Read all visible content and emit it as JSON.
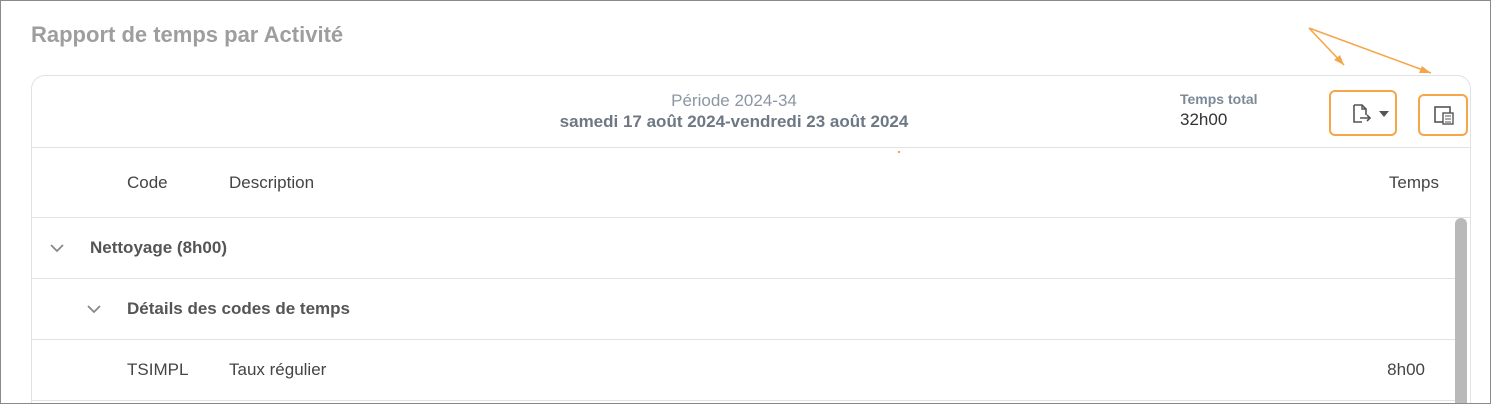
{
  "page": {
    "title": "Rapport de temps par Activité"
  },
  "header": {
    "period_label": "Période 2024-34",
    "period_range": "samedi 17 août 2024-vendredi 23 août 2024",
    "total_label": "Temps total",
    "total_value": "32h00"
  },
  "toolbar": {
    "export_icon": "export-file-icon",
    "columns_icon": "column-settings-icon",
    "accent_color": "#f5a64a"
  },
  "table": {
    "columns": {
      "code": "Code",
      "description": "Description",
      "time": "Temps"
    },
    "group": {
      "label": "Nettoyage (8h00)"
    },
    "subgroup": {
      "label": "Détails des codes de temps"
    },
    "rows": [
      {
        "code": "TSIMPL",
        "description": "Taux régulier",
        "time": "8h00"
      }
    ]
  }
}
